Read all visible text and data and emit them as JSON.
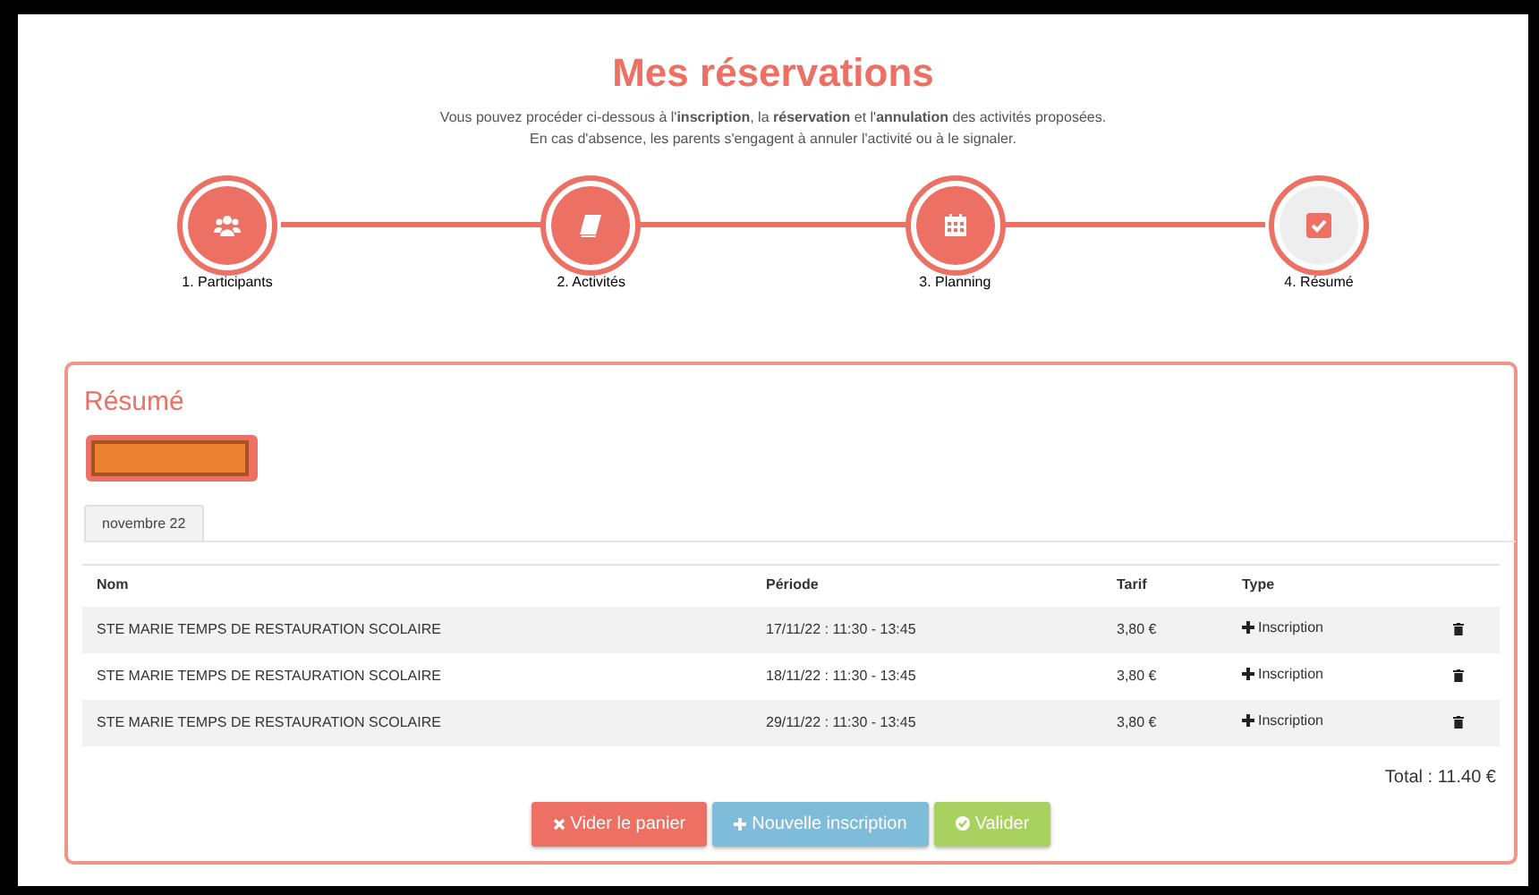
{
  "title": "Mes réservations",
  "intro": [
    "Vous pouvez procéder ci-dessous à l'**inscription**, la **réservation** et l'**annulation** des activités proposées.",
    "En cas d'absence, les parents s'engagent à annuler l'activité ou à le signaler."
  ],
  "steps": [
    {
      "label": "1. Participants",
      "kind": "users",
      "completed": true
    },
    {
      "label": "2. Activités",
      "kind": "book",
      "completed": true
    },
    {
      "label": "3. Planning",
      "kind": "calendar",
      "completed": true
    },
    {
      "label": "4. Résumé",
      "kind": "check",
      "completed": false
    }
  ],
  "summary": {
    "title": "Résumé",
    "tabs": [
      {
        "label": "novembre 22",
        "selected": true
      }
    ],
    "table": {
      "columns": [
        "Nom",
        "Période",
        "Tarif",
        "Type"
      ],
      "rows": [
        {
          "name": "STE MARIE TEMPS DE RESTAURATION SCOLAIRE",
          "period": "17/11/22 : 11:30 - 13:45",
          "price": "3,80 €",
          "type": "Inscription"
        },
        {
          "name": "STE MARIE TEMPS DE RESTAURATION SCOLAIRE",
          "period": "18/11/22 : 11:30 - 13:45",
          "price": "3,80 €",
          "type": "Inscription"
        },
        {
          "name": "STE MARIE TEMPS DE RESTAURATION SCOLAIRE",
          "period": "29/11/22 : 11:30 - 13:45",
          "price": "3,80 €",
          "type": "Inscription"
        }
      ]
    },
    "total": "Total : 11.40 €",
    "buttons": [
      {
        "label": "Vider le panier",
        "kind": "clear"
      },
      {
        "label": "Nouvelle inscription",
        "kind": "add"
      },
      {
        "label": "Valider",
        "kind": "validate"
      }
    ]
  }
}
